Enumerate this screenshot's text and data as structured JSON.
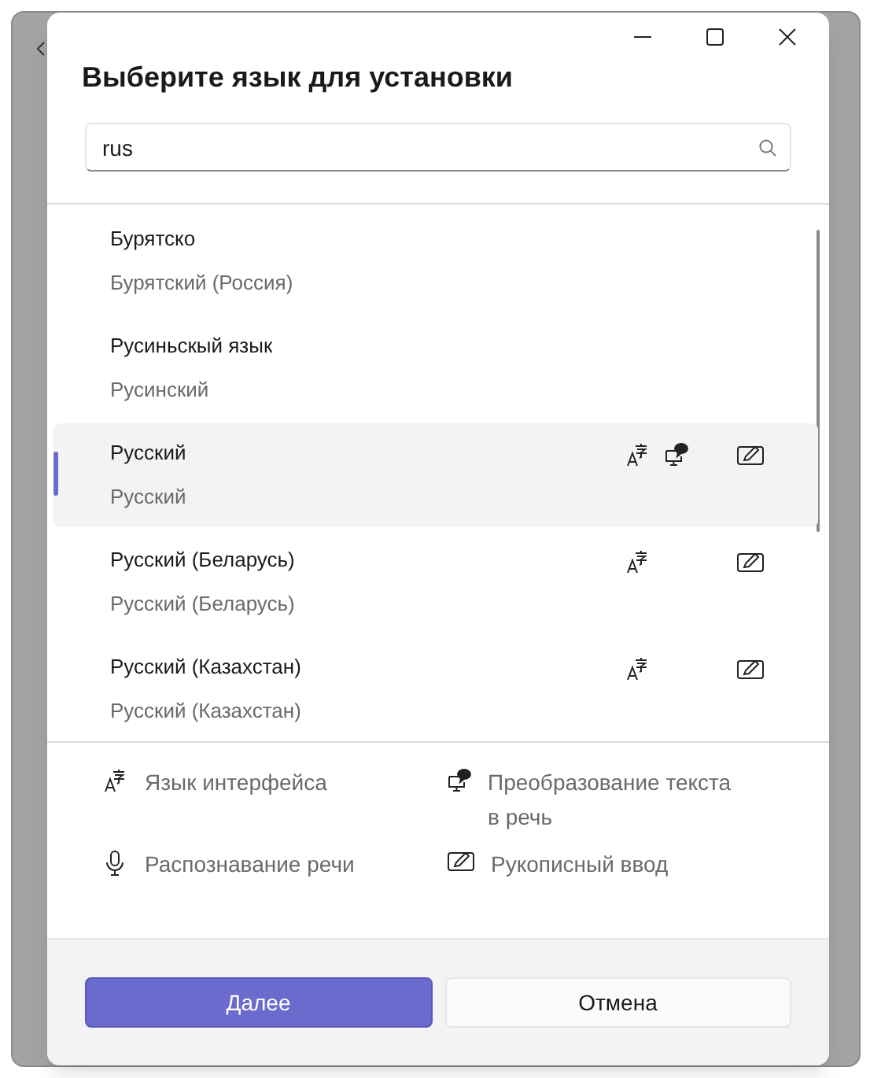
{
  "dialog": {
    "title": "Выберите язык для установки"
  },
  "search": {
    "value": "rus"
  },
  "languages": [
    {
      "name": "Бурятско",
      "native": "Бурятский (Россия)",
      "selected": false,
      "display_language": false,
      "text_to_speech": false,
      "handwriting": false
    },
    {
      "name": "Русиньскый язык",
      "native": "Русинский",
      "selected": false,
      "display_language": false,
      "text_to_speech": false,
      "handwriting": false
    },
    {
      "name": "Русский",
      "native": "Русский",
      "selected": true,
      "display_language": true,
      "text_to_speech": true,
      "handwriting": true
    },
    {
      "name": "Русский (Беларусь)",
      "native": "Русский (Беларусь)",
      "selected": false,
      "display_language": true,
      "text_to_speech": false,
      "handwriting": true
    },
    {
      "name": "Русский (Казахстан)",
      "native": "Русский (Казахстан)",
      "selected": false,
      "display_language": true,
      "text_to_speech": false,
      "handwriting": true
    }
  ],
  "legend": [
    {
      "kind": "display_language",
      "label": "Язык интерфейса"
    },
    {
      "kind": "text_to_speech",
      "label": "Преобразование текста в речь"
    },
    {
      "kind": "speech",
      "label": "Распознавание речи"
    },
    {
      "kind": "handwriting",
      "label": "Рукописный ввод"
    }
  ],
  "buttons": [
    {
      "kind": "primary",
      "label": "Далее"
    },
    {
      "kind": "secondary",
      "label": "Отмена"
    }
  ]
}
